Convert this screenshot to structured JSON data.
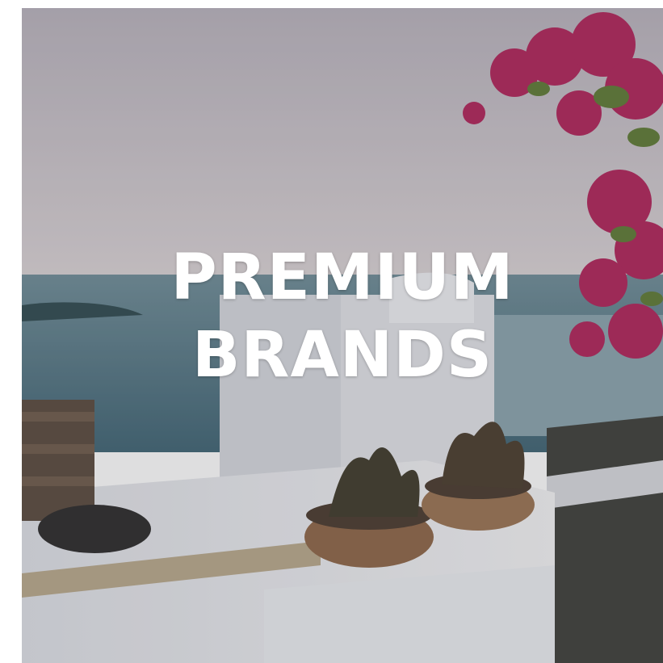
{
  "banner": {
    "line1": "PREMIUM",
    "line2": "BRANDS"
  },
  "colors": {
    "sky": "#c9c4cc",
    "sea": "#4d7282",
    "wall": "#e9eaee",
    "bougainvillea": "#b0245a",
    "leaves": "#4f6b2f",
    "text": "#ffffff"
  },
  "icons": [
    "sea-view-photo"
  ]
}
